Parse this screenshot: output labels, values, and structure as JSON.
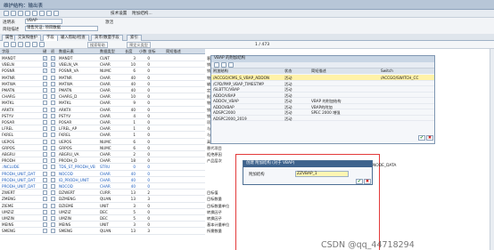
{
  "title": "维护结构：输出表",
  "toolbar": {
    "items": [
      "技术设置",
      "附加结构..."
    ]
  },
  "header": {
    "table_label": "透明表",
    "table_value": "VBAP",
    "status_label": "激活",
    "short_desc_label": "简短描述",
    "short_desc_value": "销售凭证: 项目数据"
  },
  "tabs": [
    "属性",
    "交货和维护",
    "字段",
    "输入帮助/检查",
    "货币/数量字段",
    "索引"
  ],
  "grid_toolbar": {
    "buttons": [
      "搜索帮助",
      "预定义类型"
    ],
    "pager": "1 / 473"
  },
  "grid": {
    "headers": [
      "字段",
      "键",
      "初",
      "数据元素",
      "数据类型",
      "长度",
      "小数",
      "坐标",
      "简短描述"
    ],
    "rows": [
      {
        "field": "MANDT",
        "key": true,
        "init": true,
        "elem": "MANDT",
        "type": "CLNT",
        "len": "3",
        "dec": "0",
        "desc": "客户端",
        "blue": false
      },
      {
        "field": "VBELN",
        "key": true,
        "init": true,
        "elem": "VBELN_VA",
        "type": "CHAR",
        "len": "10",
        "dec": "0",
        "desc": "销售凭证",
        "blue": false
      },
      {
        "field": "POSNR",
        "key": true,
        "init": true,
        "elem": "POSNR_VA",
        "type": "NUMC",
        "len": "6",
        "dec": "0",
        "desc": "销售凭证项目",
        "blue": false
      },
      {
        "field": "MATNR",
        "key": false,
        "init": false,
        "elem": "MATNR",
        "type": "CHAR",
        "len": "40",
        "dec": "0",
        "desc": "物料编号",
        "blue": false
      },
      {
        "field": "MATWA",
        "key": false,
        "init": false,
        "elem": "MATWA",
        "type": "CHAR",
        "len": "40",
        "dec": "0",
        "desc": "输入的物料",
        "blue": false
      },
      {
        "field": "PMATN",
        "key": false,
        "init": false,
        "elem": "PMATN",
        "type": "CHAR",
        "len": "40",
        "dec": "0",
        "desc": "定价参考物料",
        "blue": false
      },
      {
        "field": "CHARG",
        "key": false,
        "init": false,
        "elem": "CHARG_D",
        "type": "CHAR",
        "len": "10",
        "dec": "0",
        "desc": "批次编号",
        "blue": false
      },
      {
        "field": "MATKL",
        "key": false,
        "init": false,
        "elem": "MATKL",
        "type": "CHAR",
        "len": "9",
        "dec": "0",
        "desc": "物料组",
        "blue": false
      },
      {
        "field": "ARKTX",
        "key": false,
        "init": false,
        "elem": "ARKTX",
        "type": "CHAR",
        "len": "40",
        "dec": "0",
        "desc": "销售订单项目短文本",
        "blue": false
      },
      {
        "field": "PSTYV",
        "key": false,
        "init": false,
        "elem": "PSTYV",
        "type": "CHAR",
        "len": "4",
        "dec": "0",
        "desc": "销售凭证项目类别",
        "blue": false
      },
      {
        "field": "POSAR",
        "key": false,
        "init": false,
        "elem": "POSAR",
        "type": "CHAR",
        "len": "1",
        "dec": "0",
        "desc": "项目类型",
        "blue": false
      },
      {
        "field": "LFREL",
        "key": false,
        "init": false,
        "elem": "LFREL_AP",
        "type": "CHAR",
        "len": "1",
        "dec": "0",
        "desc": "与交货相关的项目",
        "blue": false
      },
      {
        "field": "FKREL",
        "key": false,
        "init": false,
        "elem": "FKREL",
        "type": "CHAR",
        "len": "1",
        "dec": "0",
        "desc": "与开票相关",
        "blue": false
      },
      {
        "field": "UEPOS",
        "key": false,
        "init": false,
        "elem": "UEPOS",
        "type": "NUMC",
        "len": "6",
        "dec": "0",
        "desc": "高层项目",
        "blue": false
      },
      {
        "field": "GRPOS",
        "key": false,
        "init": false,
        "elem": "GRPOS",
        "type": "NUMC",
        "len": "6",
        "dec": "0",
        "desc": "替代项目",
        "blue": false
      },
      {
        "field": "ABGRU",
        "key": false,
        "init": false,
        "elem": "ABGRU_VA",
        "type": "CHAR",
        "len": "2",
        "dec": "0",
        "desc": "拒绝原因",
        "blue": false
      },
      {
        "field": "PRODH",
        "key": false,
        "init": false,
        "elem": "PRODH_D",
        "type": "CHAR",
        "len": "18",
        "dec": "0",
        "desc": "产品层次",
        "blue": false
      },
      {
        "field": ".INCLUDE",
        "key": false,
        "init": false,
        "elem": "TDS_ST_PRODH_VB",
        "type": "STRU",
        "len": "0",
        "dec": "0",
        "desc": "",
        "blue": true
      },
      {
        "field": "PRODH_UNIT_DAT",
        "key": false,
        "init": false,
        "elem": "NOCOD",
        "type": "CHAR",
        "len": "40",
        "dec": "0",
        "desc": "",
        "blue": true
      },
      {
        "field": "PRODH_UNIT_DAT",
        "key": false,
        "init": false,
        "elem": "ID_PRODH_UNIT",
        "type": "CHAR",
        "len": "40",
        "dec": "0",
        "desc": "",
        "blue": true
      },
      {
        "field": "PRODH_UNIT_DAT",
        "key": false,
        "init": false,
        "elem": "NOCOD",
        "type": "CHAR",
        "len": "40",
        "dec": "0",
        "desc": "",
        "blue": true
      },
      {
        "field": "ZWERT",
        "key": false,
        "init": false,
        "elem": "DZWERT",
        "type": "CURR",
        "len": "13",
        "dec": "2",
        "desc": "目标值",
        "blue": false
      },
      {
        "field": "ZMENG",
        "key": false,
        "init": false,
        "elem": "DZMENG",
        "type": "QUAN",
        "len": "13",
        "dec": "3",
        "desc": "目标数量",
        "blue": false
      },
      {
        "field": "ZIEME",
        "key": false,
        "init": false,
        "elem": "DZIEME",
        "type": "UNIT",
        "len": "3",
        "dec": "0",
        "desc": "目标数量单位",
        "blue": false
      },
      {
        "field": "UMZIZ",
        "key": false,
        "init": false,
        "elem": "UMZIZ",
        "type": "DEC",
        "len": "5",
        "dec": "0",
        "desc": "转换因子",
        "blue": false
      },
      {
        "field": "UMZIN",
        "key": false,
        "init": false,
        "elem": "UMZIN",
        "type": "DEC",
        "len": "5",
        "dec": "0",
        "desc": "转换因子",
        "blue": false
      },
      {
        "field": "MEINS",
        "key": false,
        "init": false,
        "elem": "MEINS",
        "type": "UNIT",
        "len": "3",
        "dec": "0",
        "desc": "基本计量单位",
        "blue": false
      },
      {
        "field": "SMENG",
        "key": false,
        "init": false,
        "elem": "SMENG",
        "type": "QUAN",
        "len": "13",
        "dec": "3",
        "desc": "所需数量",
        "blue": false
      }
    ]
  },
  "popup_append": {
    "title": "VBAP 的附加结构",
    "headers": [
      "附加结构",
      "状态",
      "简短描述",
      "Switch"
    ],
    "rows": [
      {
        "name": "/ACCGO/CMS_S_VBAP_ADDON",
        "status": "活动",
        "desc": "",
        "switch": "/ACCGO/SWITCH_CC",
        "selected": true
      },
      {
        "name": "/CPD/PMP_VBAP_TIMESTMP",
        "status": "活动",
        "desc": "",
        "switch": "",
        "selected": false
      },
      {
        "name": "/SLBTTC/VBAP",
        "status": "活动",
        "desc": "",
        "switch": "",
        "selected": false
      },
      {
        "name": "ADDO/VBAP",
        "status": "活动",
        "desc": "",
        "switch": "",
        "selected": false
      },
      {
        "name": "ADDOV_VBAP",
        "status": "活动",
        "desc": "VBAP 的附加结构",
        "switch": "",
        "selected": false
      },
      {
        "name": "ADDOVBAP",
        "status": "活动",
        "desc": "VBAP的附加",
        "switch": "",
        "selected": false
      },
      {
        "name": "ADSPC2000",
        "status": "活动",
        "desc": "SPEC 2000 增强",
        "switch": "",
        "selected": false
      },
      {
        "name": "ADSPC2000_2019",
        "status": "活动",
        "desc": "",
        "switch": "",
        "selected": false
      }
    ]
  },
  "popup_create": {
    "title": "创建 附加结构 (对于 VBAP)",
    "label": "附加结构",
    "value": "ZZVBAP_1"
  },
  "right_text": "NODE_DATA",
  "watermark": "CSDN @qq_44718294"
}
